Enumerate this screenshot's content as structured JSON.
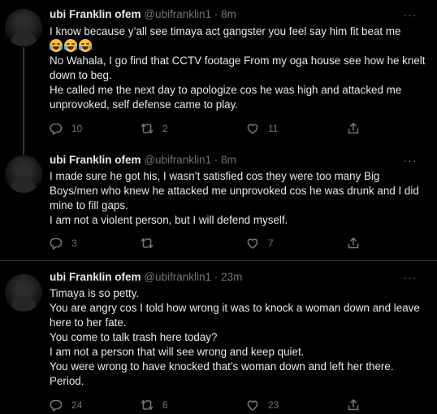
{
  "tweets": [
    {
      "name": "ubi Franklin ofem",
      "handle": "@ubifranklin1",
      "separator": "·",
      "time": "8m",
      "lines": [
        "I know because y’all see timaya act gangster you feel say him fit beat me",
        "No Wahala, I go find that CCTV footage From my oga house see how he knelt down to beg.",
        "He called me the next day to apologize cos he was high and attacked me unprovoked, self defense came to play."
      ],
      "emoji": [
        "face-with-tears-of-joy",
        "face-with-tears-of-joy",
        "face-with-tears-of-joy"
      ],
      "replies": "10",
      "retweets": "2",
      "likes": "11"
    },
    {
      "name": "ubi Franklin ofem",
      "handle": "@ubifranklin1",
      "separator": "·",
      "time": "8m",
      "lines": [
        "I made sure he got his, I wasn’t satisfied cos they were too many Big Boys/men who knew he attacked me unprovoked cos he was drunk and I did mine to fill gaps.",
        "I am not a violent person, but I will defend myself."
      ],
      "replies": "3",
      "retweets": "",
      "likes": "7"
    },
    {
      "name": "ubi Franklin ofem",
      "handle": "@ubifranklin1",
      "separator": "·",
      "time": "23m",
      "lines": [
        "Timaya is so petty.",
        "You are angry cos I told how wrong it was to knock a woman down and leave here to her fate.",
        "You come to talk trash here today?",
        "I am not a person that will see wrong and keep quiet.",
        "You were wrong to have knocked that’s woman down and left her there. Period."
      ],
      "replies": "24",
      "retweets": "6",
      "likes": "23"
    }
  ],
  "more_label": "···",
  "icons": {
    "reply": "reply-icon",
    "retweet": "retweet-icon",
    "like": "heart-icon",
    "share": "share-icon",
    "more": "more-icon"
  },
  "colors": {
    "background": "#000000",
    "text": "#e7e9ea",
    "secondary": "#71767b",
    "divider": "#2f3336"
  }
}
